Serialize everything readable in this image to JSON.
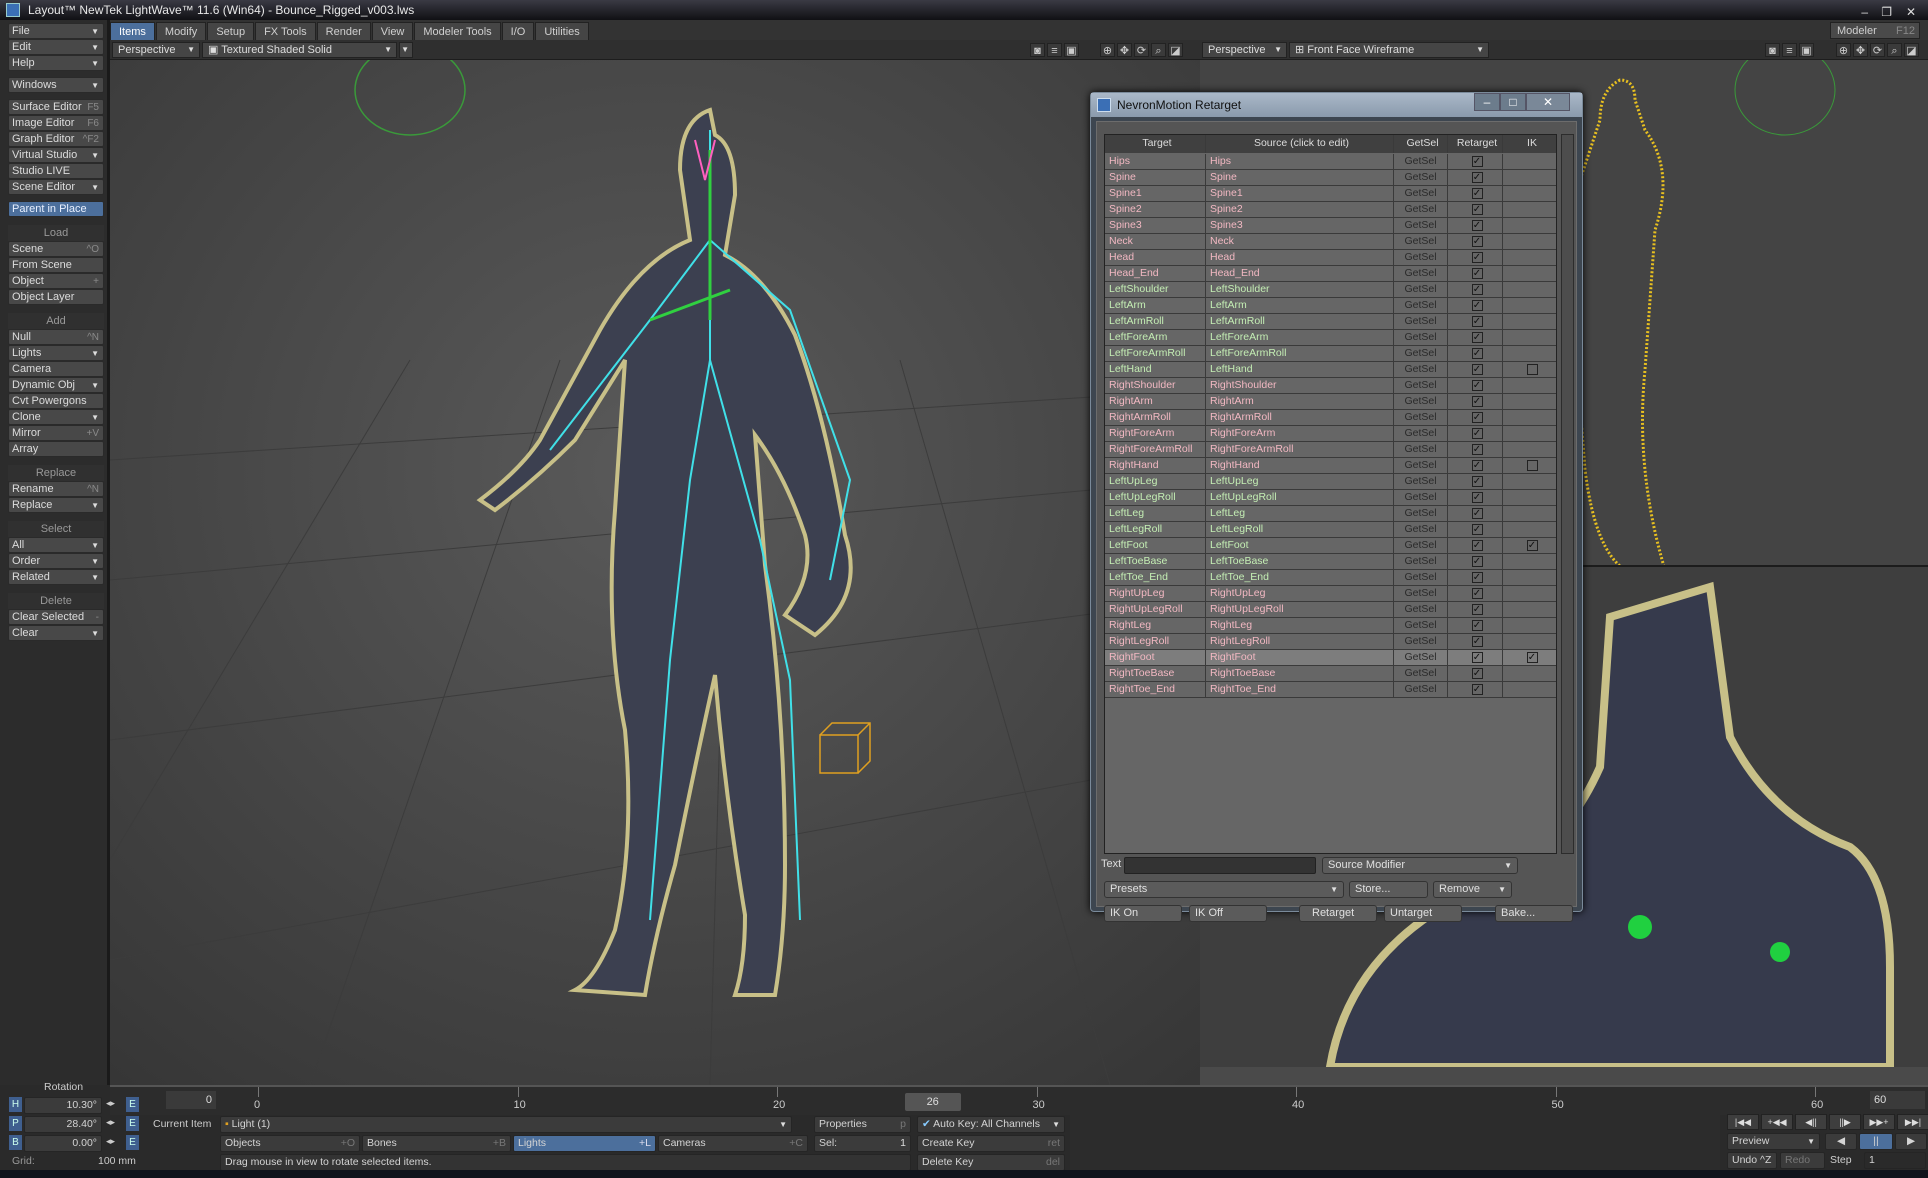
{
  "window": {
    "title": "Layout™ NewTek LightWave™ 11.6 (Win64) - Bounce_Rigged_v003.lws"
  },
  "tabs": [
    "Items",
    "Modify",
    "Setup",
    "FX Tools",
    "Render",
    "View",
    "Modeler Tools",
    "I/O",
    "Utilities"
  ],
  "active_tab": "Items",
  "modeler": {
    "label": "Modeler",
    "shortcut": "F12"
  },
  "sidebar": [
    {
      "type": "item",
      "label": "File",
      "dd": true
    },
    {
      "type": "item",
      "label": "Edit",
      "dd": true
    },
    {
      "type": "item",
      "label": "Help",
      "dd": true
    },
    {
      "type": "gap"
    },
    {
      "type": "item",
      "label": "Windows",
      "dd": true
    },
    {
      "type": "gap"
    },
    {
      "type": "item",
      "label": "Surface Editor",
      "sc": "F5"
    },
    {
      "type": "item",
      "label": "Image Editor",
      "sc": "F6"
    },
    {
      "type": "item",
      "label": "Graph Editor",
      "sc": "^F2"
    },
    {
      "type": "item",
      "label": "Virtual Studio",
      "dd": true
    },
    {
      "type": "item",
      "label": "Studio LIVE"
    },
    {
      "type": "item",
      "label": "Scene Editor",
      "dd": true
    },
    {
      "type": "gap"
    },
    {
      "type": "item",
      "label": "Parent in Place",
      "hl": true
    },
    {
      "type": "head",
      "label": "Load"
    },
    {
      "type": "item",
      "label": "Scene",
      "sc": "^O"
    },
    {
      "type": "item",
      "label": "From Scene"
    },
    {
      "type": "item",
      "label": "Object",
      "sc": "+"
    },
    {
      "type": "item",
      "label": "Object Layer"
    },
    {
      "type": "head",
      "label": "Add"
    },
    {
      "type": "item",
      "label": "Null",
      "sc": "^N"
    },
    {
      "type": "item",
      "label": "Lights",
      "dd": true
    },
    {
      "type": "item",
      "label": "Camera"
    },
    {
      "type": "item",
      "label": "Dynamic Obj",
      "dd": true
    },
    {
      "type": "item",
      "label": "Cvt Powergons"
    },
    {
      "type": "item",
      "label": "Clone",
      "dd": true
    },
    {
      "type": "item",
      "label": "Mirror",
      "sc": "+V"
    },
    {
      "type": "item",
      "label": "Array"
    },
    {
      "type": "head",
      "label": "Replace"
    },
    {
      "type": "item",
      "label": "Rename",
      "sc": "^N"
    },
    {
      "type": "item",
      "label": "Replace",
      "dd": true
    },
    {
      "type": "head",
      "label": "Select"
    },
    {
      "type": "item",
      "label": "All",
      "dd": true
    },
    {
      "type": "item",
      "label": "Order",
      "dd": true
    },
    {
      "type": "item",
      "label": "Related",
      "dd": true
    },
    {
      "type": "head",
      "label": "Delete"
    },
    {
      "type": "item",
      "label": "Clear Selected",
      "sc": "-"
    },
    {
      "type": "item",
      "label": "Clear",
      "dd": true
    }
  ],
  "viewport_main": {
    "view": "Perspective",
    "mode": "Textured Shaded Solid"
  },
  "viewport_right": {
    "view": "Perspective",
    "mode": "Front Face Wireframe"
  },
  "dialog": {
    "title": "NevronMotion Retarget",
    "columns": [
      "Target",
      "Source (click to edit)",
      "GetSel",
      "Retarget",
      "IK"
    ],
    "getsel_label": "GetSel",
    "colors": {
      "left": "#c4eeb4",
      "other": "#f2b8c2"
    },
    "rows": [
      {
        "target": "Hips",
        "source": "Hips",
        "side": "other",
        "retarget": true,
        "ik": null
      },
      {
        "target": "Spine",
        "source": "Spine",
        "side": "other",
        "retarget": true,
        "ik": null
      },
      {
        "target": "Spine1",
        "source": "Spine1",
        "side": "other",
        "retarget": true,
        "ik": null
      },
      {
        "target": "Spine2",
        "source": "Spine2",
        "side": "other",
        "retarget": true,
        "ik": null
      },
      {
        "target": "Spine3",
        "source": "Spine3",
        "side": "other",
        "retarget": true,
        "ik": null
      },
      {
        "target": "Neck",
        "source": "Neck",
        "side": "other",
        "retarget": true,
        "ik": null
      },
      {
        "target": "Head",
        "source": "Head",
        "side": "other",
        "retarget": true,
        "ik": null
      },
      {
        "target": "Head_End",
        "source": "Head_End",
        "side": "other",
        "retarget": true,
        "ik": null
      },
      {
        "target": "LeftShoulder",
        "source": "LeftShoulder",
        "side": "left",
        "retarget": true,
        "ik": null
      },
      {
        "target": "LeftArm",
        "source": "LeftArm",
        "side": "left",
        "retarget": true,
        "ik": null
      },
      {
        "target": "LeftArmRoll",
        "source": "LeftArmRoll",
        "side": "left",
        "retarget": true,
        "ik": null
      },
      {
        "target": "LeftForeArm",
        "source": "LeftForeArm",
        "side": "left",
        "retarget": true,
        "ik": null
      },
      {
        "target": "LeftForeArmRoll",
        "source": "LeftForeArmRoll",
        "side": "left",
        "retarget": true,
        "ik": null
      },
      {
        "target": "LeftHand",
        "source": "LeftHand",
        "side": "left",
        "retarget": true,
        "ik": false
      },
      {
        "target": "RightShoulder",
        "source": "RightShoulder",
        "side": "other",
        "retarget": true,
        "ik": null
      },
      {
        "target": "RightArm",
        "source": "RightArm",
        "side": "other",
        "retarget": true,
        "ik": null
      },
      {
        "target": "RightArmRoll",
        "source": "RightArmRoll",
        "side": "other",
        "retarget": true,
        "ik": null
      },
      {
        "target": "RightForeArm",
        "source": "RightForeArm",
        "side": "other",
        "retarget": true,
        "ik": null
      },
      {
        "target": "RightForeArmRoll",
        "source": "RightForeArmRoll",
        "side": "other",
        "retarget": true,
        "ik": null
      },
      {
        "target": "RightHand",
        "source": "RightHand",
        "side": "other",
        "retarget": true,
        "ik": false
      },
      {
        "target": "LeftUpLeg",
        "source": "LeftUpLeg",
        "side": "left",
        "retarget": true,
        "ik": null
      },
      {
        "target": "LeftUpLegRoll",
        "source": "LeftUpLegRoll",
        "side": "left",
        "retarget": true,
        "ik": null
      },
      {
        "target": "LeftLeg",
        "source": "LeftLeg",
        "side": "left",
        "retarget": true,
        "ik": null
      },
      {
        "target": "LeftLegRoll",
        "source": "LeftLegRoll",
        "side": "left",
        "retarget": true,
        "ik": null
      },
      {
        "target": "LeftFoot",
        "source": "LeftFoot",
        "side": "left",
        "retarget": true,
        "ik": true
      },
      {
        "target": "LeftToeBase",
        "source": "LeftToeBase",
        "side": "left",
        "retarget": true,
        "ik": null
      },
      {
        "target": "LeftToe_End",
        "source": "LeftToe_End",
        "side": "left",
        "retarget": true,
        "ik": null
      },
      {
        "target": "RightUpLeg",
        "source": "RightUpLeg",
        "side": "other",
        "retarget": true,
        "ik": null
      },
      {
        "target": "RightUpLegRoll",
        "source": "RightUpLegRoll",
        "side": "other",
        "retarget": true,
        "ik": null
      },
      {
        "target": "RightLeg",
        "source": "RightLeg",
        "side": "other",
        "retarget": true,
        "ik": null
      },
      {
        "target": "RightLegRoll",
        "source": "RightLegRoll",
        "side": "other",
        "retarget": true,
        "ik": null
      },
      {
        "target": "RightFoot",
        "source": "RightFoot",
        "side": "other",
        "retarget": true,
        "ik": true,
        "selected": true
      },
      {
        "target": "RightToeBase",
        "source": "RightToeBase",
        "side": "other",
        "retarget": true,
        "ik": null
      },
      {
        "target": "RightToe_End",
        "source": "RightToe_End",
        "side": "other",
        "retarget": true,
        "ik": null
      }
    ],
    "text_label": "Text",
    "text_value": "",
    "source_modifier": "Source Modifier",
    "presets": "Presets",
    "store": "Store...",
    "remove": "Remove",
    "ik_on": "IK On",
    "ik_off": "IK Off",
    "retarget": "Retarget",
    "untarget": "Untarget",
    "bake": "Bake..."
  },
  "bottom": {
    "rotation_label": "Rotation",
    "h": {
      "label": "H",
      "value": "10.30°"
    },
    "p": {
      "label": "P",
      "value": "28.40°"
    },
    "b": {
      "label": "B",
      "value": "0.00°"
    },
    "e_label": "E",
    "grid_label": "Grid:",
    "grid_value": "100 mm",
    "start_frame": "0",
    "end_frame": "60",
    "current_frame": "26",
    "ticks": [
      "0",
      "10",
      "20",
      "30",
      "40",
      "50",
      "60"
    ],
    "current_item_label": "Current Item",
    "current_item": "Light (1)",
    "properties": "Properties",
    "properties_sc": "p",
    "auto_key": "Auto Key: All Channels",
    "objects": "Objects",
    "objects_sc": "+O",
    "bones": "Bones",
    "bones_sc": "+B",
    "lights": "Lights",
    "lights_sc": "+L",
    "cameras": "Cameras",
    "cameras_sc": "+C",
    "sel_label": "Sel:",
    "sel_value": "1",
    "create_key": "Create Key",
    "create_key_sc": "ret",
    "delete_key": "Delete Key",
    "delete_key_sc": "del",
    "status": "Drag mouse in view to rotate selected items.",
    "preview": "Preview",
    "undo": "Undo ^Z",
    "redo": "Redo",
    "step_label": "Step",
    "step_value": "1",
    "transport": [
      "|◀◀",
      "+◀◀",
      "◀||",
      "||▶",
      "▶▶+",
      "▶▶|"
    ]
  }
}
